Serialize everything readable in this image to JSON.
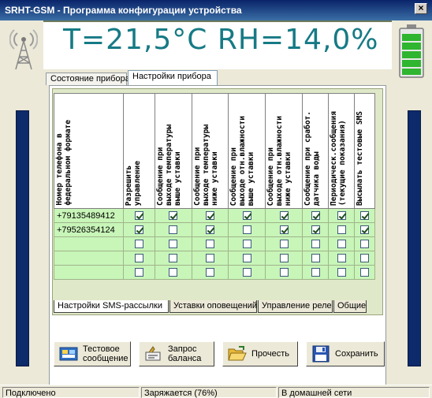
{
  "window": {
    "title": "SRHT-GSM - Программа конфигурации устройства",
    "close_label": "×"
  },
  "readout": {
    "text": "T=21,5°C  RH=14,0%"
  },
  "top_tabs": [
    {
      "label": "Состояние прибора",
      "active": false
    },
    {
      "label": "Настройки прибора",
      "active": true
    }
  ],
  "table": {
    "headers": [
      "Номер телефона в\nфедеральном формате",
      "Разрешить\nуправление",
      "Сообщение при\nвыходе температуры\nвыше уставки",
      "Сообщение при\nвыходе температуры\nниже уставки",
      "Сообщение при\nвыходе отн.влажности\nвыше уставки",
      "Сообщение при\nвыходе отн.влажности\nниже уставки",
      "Сообщение при сработ.\nдатчика воды",
      "Периодическ.сообщения\n(текущие показания)",
      "Высылать тестовые SMS"
    ],
    "rows": [
      {
        "phone": "+79135489412",
        "checks": [
          true,
          true,
          true,
          true,
          true,
          true,
          true,
          true
        ]
      },
      {
        "phone": "+79526354124",
        "checks": [
          true,
          false,
          true,
          false,
          true,
          true,
          false,
          true
        ]
      },
      {
        "phone": "",
        "checks": [
          false,
          false,
          false,
          false,
          false,
          false,
          false,
          false
        ]
      },
      {
        "phone": "",
        "checks": [
          false,
          false,
          false,
          false,
          false,
          false,
          false,
          false
        ]
      },
      {
        "phone": "",
        "checks": [
          false,
          false,
          false,
          false,
          false,
          false,
          false,
          false
        ]
      }
    ]
  },
  "sub_tabs": [
    {
      "label": "Настройки SMS-рассылки",
      "active": true
    },
    {
      "label": "Уставки оповещений",
      "active": false
    },
    {
      "label": "Управление реле",
      "active": false
    },
    {
      "label": "Общие",
      "active": false
    }
  ],
  "buttons": {
    "test_message": "Тестовое\nсообщение",
    "balance": "Запрос\nбаланса",
    "read": "Прочесть",
    "save": "Сохранить"
  },
  "icons": {
    "antenna": "antenna-icon",
    "battery": "battery-icon",
    "test_message": "test-message-icon",
    "balance": "balance-icon",
    "read": "open-folder-icon",
    "save": "floppy-disk-icon"
  },
  "status": {
    "connection": "Подключено",
    "charging": "Заряжается (76%)",
    "network": "В домашней сети"
  },
  "colors": {
    "readout": "#167a85",
    "row_fill": "#c8f5b8",
    "accent_bar": "#0d2a6a"
  }
}
